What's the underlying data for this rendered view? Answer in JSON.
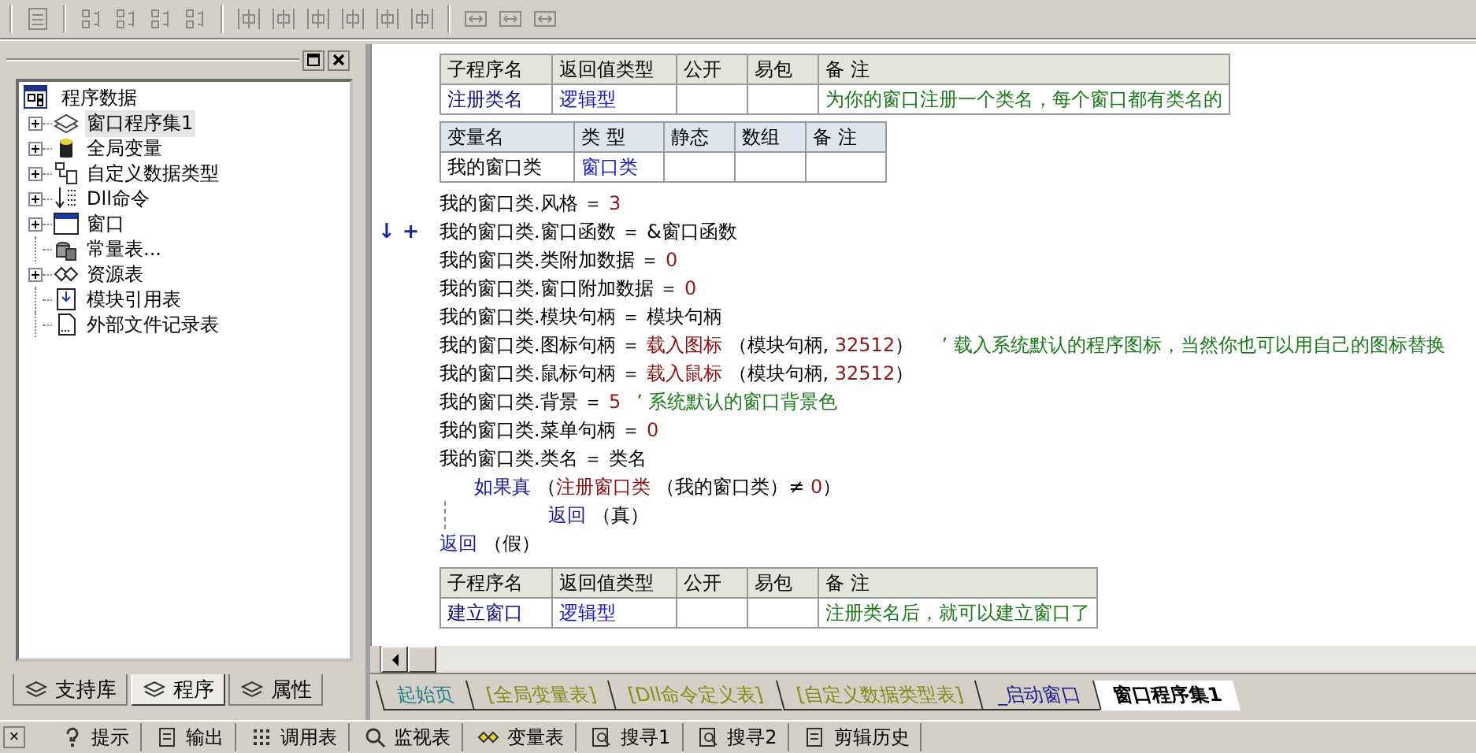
{
  "panel": {
    "root": "程序数据",
    "items": [
      {
        "label": "窗口程序集1",
        "kind": "program_set",
        "expandable": true,
        "selected": true
      },
      {
        "label": "全局变量",
        "kind": "global_var",
        "expandable": true,
        "selected": false
      },
      {
        "label": "自定义数据类型",
        "kind": "custom_type",
        "expandable": true,
        "selected": false
      },
      {
        "label": "Dll命令",
        "kind": "dll",
        "expandable": true,
        "selected": false
      },
      {
        "label": "窗口",
        "kind": "window",
        "expandable": true,
        "selected": false
      },
      {
        "label": "常量表...",
        "kind": "constants",
        "expandable": false,
        "selected": false
      },
      {
        "label": "资源表",
        "kind": "resources",
        "expandable": true,
        "selected": false
      },
      {
        "label": "模块引用表",
        "kind": "module_ref",
        "expandable": false,
        "selected": false
      },
      {
        "label": "外部文件记录表",
        "kind": "file_record",
        "expandable": false,
        "selected": false
      }
    ],
    "tabs": [
      {
        "label": "支持库",
        "selected": false
      },
      {
        "label": "程序",
        "selected": true
      },
      {
        "label": "属性",
        "selected": false
      }
    ]
  },
  "editor": {
    "blocks": [
      {
        "kind": "sub_table",
        "columns": [
          "子程序名",
          "返回值类型",
          "公开",
          "易包",
          "备 注"
        ],
        "row": [
          {
            "text": "注册类名",
            "kind": "name"
          },
          {
            "text": "逻辑型",
            "kind": "type"
          },
          {
            "kind": "plain"
          },
          {
            "kind": "plain"
          },
          {
            "text": "为你的窗口注册一个类名，每个窗口都有类名的",
            "kind": "note"
          }
        ]
      },
      {
        "kind": "var_table",
        "columns": [
          "变量名",
          "类 型",
          "静态",
          "数组",
          "备 注"
        ],
        "row": [
          {
            "text": "我的窗口类",
            "kind": "plain"
          },
          {
            "text": "窗口类",
            "kind": "type"
          },
          {
            "kind": "plain"
          },
          {
            "kind": "plain"
          },
          {
            "kind": "plain"
          }
        ]
      },
      {
        "kind": "code",
        "lines": [
          {
            "segments": [
              {
                "kind": "plain",
                "text": "我的窗口类.风格 ＝ "
              },
              {
                "kind": "num",
                "text": "3"
              }
            ]
          },
          {
            "gutter": "↓ +",
            "segments": [
              {
                "kind": "plain",
                "text": "我的窗口类.窗口函数 ＝ &窗口函数"
              }
            ]
          },
          {
            "segments": [
              {
                "kind": "plain",
                "text": "我的窗口类.类附加数据 ＝ "
              },
              {
                "kind": "num",
                "text": "0"
              }
            ]
          },
          {
            "segments": [
              {
                "kind": "plain",
                "text": "我的窗口类.窗口附加数据 ＝ "
              },
              {
                "kind": "num",
                "text": "0"
              }
            ]
          },
          {
            "segments": [
              {
                "kind": "plain",
                "text": "我的窗口类.模块句柄 ＝ 模块句柄"
              }
            ]
          },
          {
            "segments": [
              {
                "kind": "plain",
                "text": "我的窗口类.图标句柄 ＝ "
              },
              {
                "kind": "func",
                "text": "载入图标"
              },
              {
                "kind": "plain",
                "text": " （模块句柄, "
              },
              {
                "kind": "num",
                "text": "32512"
              },
              {
                "kind": "plain",
                "text": "）  "
              },
              {
                "kind": "comment",
                "text": "’ 载入系统默认的程序图标，当然你也可以用自己的图标替换"
              }
            ]
          },
          {
            "segments": [
              {
                "kind": "plain",
                "text": "我的窗口类.鼠标句柄 ＝ "
              },
              {
                "kind": "func",
                "text": "载入鼠标"
              },
              {
                "kind": "plain",
                "text": " （模块句柄, "
              },
              {
                "kind": "num",
                "text": "32512"
              },
              {
                "kind": "plain",
                "text": "）"
              }
            ]
          },
          {
            "segments": [
              {
                "kind": "plain",
                "text": "我的窗口类.背景 ＝ "
              },
              {
                "kind": "num",
                "text": "5"
              },
              {
                "kind": "comment",
                "text": "’ 系统默认的窗口背景色"
              }
            ]
          },
          {
            "segments": [
              {
                "kind": "plain",
                "text": "我的窗口类.菜单句柄 ＝ "
              },
              {
                "kind": "num",
                "text": "0"
              }
            ]
          },
          {
            "segments": [
              {
                "kind": "plain",
                "text": "我的窗口类.类名 ＝ 类名"
              }
            ]
          },
          {
            "segments": [
              {
                "kind": "keyword",
                "text": "如果真"
              },
              {
                "kind": "plain",
                "text": " （"
              },
              {
                "kind": "func",
                "text": "注册窗口类"
              },
              {
                "kind": "plain",
                "text": " （我的窗口类）≠ "
              },
              {
                "kind": "num",
                "text": "0"
              },
              {
                "kind": "plain",
                "text": "）"
              }
            ],
            "children": [
              {
                "segments": [
                  {
                    "kind": "keyword",
                    "text": "返回"
                  },
                  {
                    "kind": "plain",
                    "text": " （真）"
                  }
                ]
              }
            ]
          },
          {
            "segments": [
              {
                "kind": "keyword",
                "text": "返回"
              },
              {
                "kind": "plain",
                "text": " （假）"
              }
            ]
          }
        ]
      },
      {
        "kind": "sub_table",
        "columns": [
          "子程序名",
          "返回值类型",
          "公开",
          "易包",
          "备 注"
        ],
        "row": [
          {
            "text": "建立窗口",
            "kind": "name"
          },
          {
            "text": "逻辑型",
            "kind": "type"
          },
          {
            "kind": "plain"
          },
          {
            "kind": "plain"
          },
          {
            "text": "注册类名后，就可以建立窗口了",
            "kind": "note"
          }
        ]
      }
    ]
  },
  "doc_tabs": [
    {
      "label": "起始页",
      "color": "#1f7f8a",
      "selected": false
    },
    {
      "label": "[全局变量表]",
      "color": "#8a8a1a",
      "selected": false
    },
    {
      "label": "[Dll命令定义表]",
      "color": "#8a8a1a",
      "selected": false
    },
    {
      "label": "[自定义数据类型表]",
      "color": "#8a8a1a",
      "selected": false
    },
    {
      "label": "_启动窗口",
      "color": "#1a1a8a",
      "selected": false
    },
    {
      "label": "窗口程序集1",
      "color": "#000000",
      "selected": true
    }
  ],
  "bottom_bar": {
    "close": "×",
    "tools": [
      {
        "label": "提示",
        "kind": "hint"
      },
      {
        "label": "输出",
        "kind": "output"
      },
      {
        "label": "调用表",
        "kind": "calls"
      },
      {
        "label": "监视表",
        "kind": "watch"
      },
      {
        "label": "变量表",
        "kind": "vars"
      },
      {
        "label": "搜寻1",
        "kind": "find"
      },
      {
        "label": "搜寻2",
        "kind": "find"
      },
      {
        "label": "剪辑历史",
        "kind": "clip"
      }
    ]
  }
}
